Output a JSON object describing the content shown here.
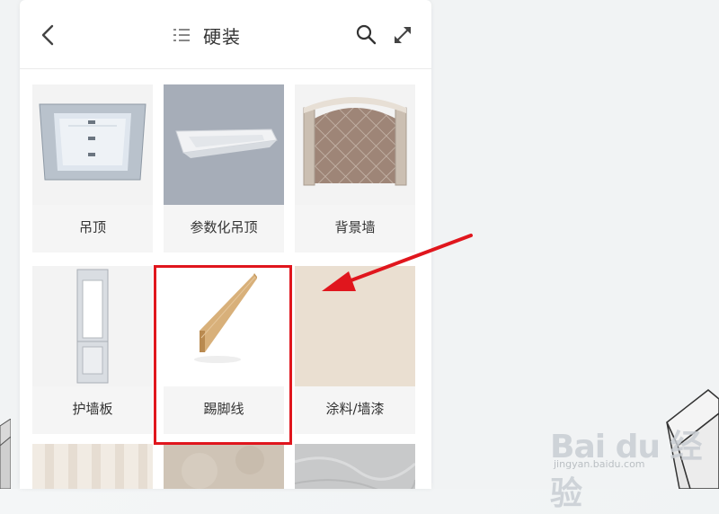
{
  "header": {
    "title": "硬装"
  },
  "categories": [
    {
      "label": "吊顶"
    },
    {
      "label": "参数化吊顶"
    },
    {
      "label": "背景墙"
    },
    {
      "label": "护墙板"
    },
    {
      "label": "踢脚线"
    },
    {
      "label": "涂料/墙漆"
    }
  ],
  "watermark": {
    "brand": "Bai du 经验",
    "url": "jingyan.baidu.com"
  },
  "colors": {
    "highlight": "#e0161d",
    "panel_bg": "#ffffff",
    "card_bg": "#f5f5f5"
  }
}
